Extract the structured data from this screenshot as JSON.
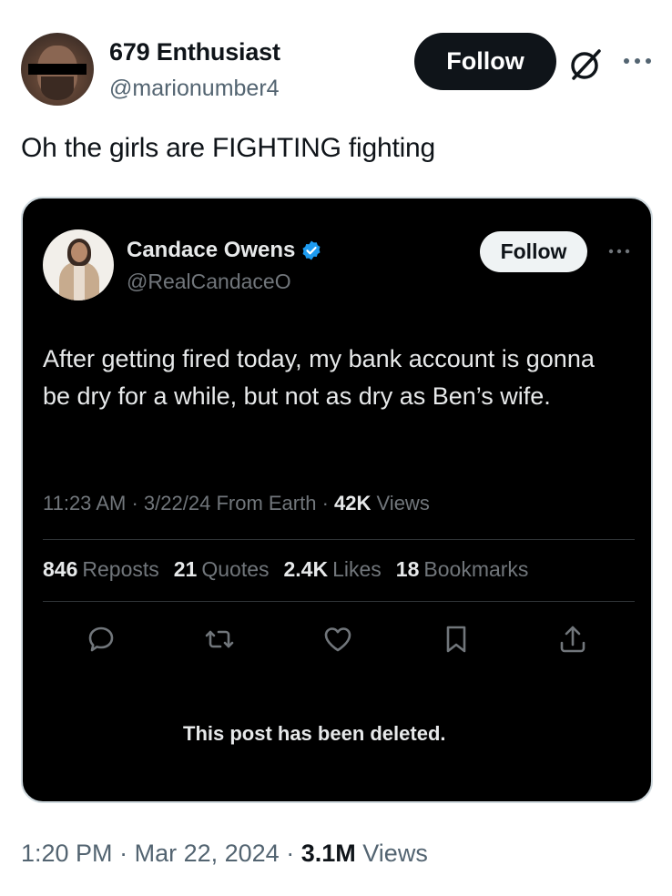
{
  "post": {
    "author_name": "679 Enthusiast",
    "author_handle": "@marionumber4",
    "follow_label": "Follow",
    "text": "Oh the girls are FIGHTING fighting",
    "time": "1:20 PM",
    "date": "Mar 22, 2024",
    "views_count": "3.1M",
    "views_label": "Views",
    "separator": "·"
  },
  "quoted": {
    "author_name": "Candace Owens",
    "author_handle": "@RealCandaceO",
    "follow_label": "Follow",
    "text": "After getting fired today, my bank account is gonna be dry for a while, but not as dry as Ben’s wife.",
    "time": "11:23 AM",
    "date": "3/22/24",
    "source": "From Earth",
    "views_count": "42K",
    "views_label": "Views",
    "separator": "·",
    "stats": [
      {
        "count": "846",
        "label": "Reposts"
      },
      {
        "count": "21",
        "label": "Quotes"
      },
      {
        "count": "2.4K",
        "label": "Likes"
      },
      {
        "count": "18",
        "label": "Bookmarks"
      }
    ],
    "deleted_notice": "This post has been deleted."
  },
  "icons": {
    "verified": "verified-badge-icon",
    "more": "more-icon",
    "grok": "grok-icon",
    "reply": "reply-icon",
    "repost": "repost-icon",
    "like": "like-icon",
    "bookmark": "bookmark-icon",
    "share": "share-icon"
  },
  "colors": {
    "verified_blue": "#1d9bf0",
    "dark_bg": "#000000",
    "muted": "#71767b"
  }
}
